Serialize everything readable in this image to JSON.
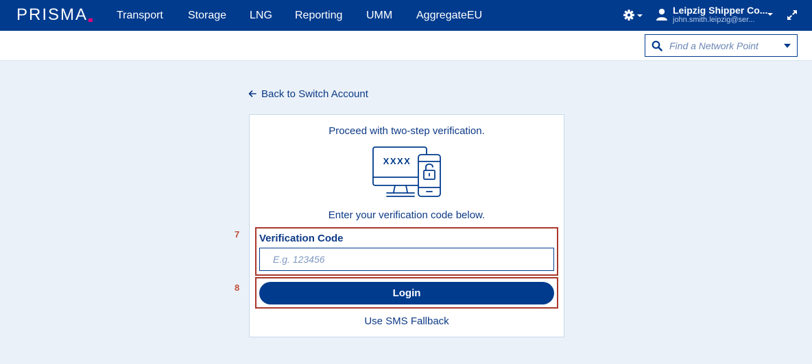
{
  "header": {
    "logo": "PRISMA",
    "nav": [
      "Transport",
      "Storage",
      "LNG",
      "Reporting",
      "UMM",
      "AggregateEU"
    ],
    "user_name": "Leipzig Shipper Co...",
    "user_email": "john.smith.leipzig@ser...",
    "icons": [
      "gear-icon",
      "user-icon",
      "expand-icon"
    ]
  },
  "network_point": {
    "placeholder": "Find a Network Point"
  },
  "back_link": "Back to Switch Account",
  "card": {
    "title": "Proceed with two-step verification.",
    "illustration_text": "XXXX",
    "subtitle": "Enter your verification code below.",
    "field_label": "Verification Code",
    "field_placeholder": "E.g. 123456",
    "login_label": "Login",
    "sms_label": "Use SMS Fallback"
  },
  "annotations": [
    "7",
    "8"
  ],
  "colors": {
    "primary": "#003b8e",
    "accent": "#e6007e",
    "background": "#eaf1f8",
    "annotation": "#a8372a"
  }
}
